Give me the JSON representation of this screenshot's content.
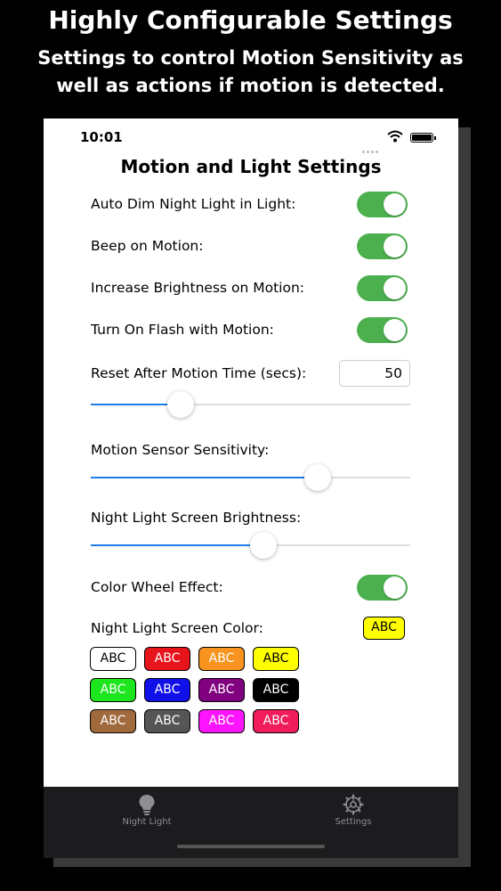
{
  "promo": {
    "title": "Highly Configurable Settings",
    "subtitle_line1": "Settings to control Motion Sensitivity as",
    "subtitle_line2": "well as actions if motion is detected."
  },
  "status_bar": {
    "time": "10:01"
  },
  "screen": {
    "title": "Motion and Light Settings",
    "toggles": [
      {
        "label": "Auto Dim Night Light in Light:",
        "on": true
      },
      {
        "label": "Beep on Motion:",
        "on": true
      },
      {
        "label": "Increase Brightness on Motion:",
        "on": true
      },
      {
        "label": "Turn On Flash with Motion:",
        "on": true
      }
    ],
    "reset_time": {
      "label": "Reset After Motion Time (secs):",
      "value": "50",
      "slider_fraction": 0.28
    },
    "motion_sensitivity": {
      "label": "Motion Sensor Sensitivity:",
      "slider_fraction": 0.71
    },
    "screen_brightness": {
      "label": "Night Light Screen Brightness:",
      "slider_fraction": 0.54
    },
    "color_wheel": {
      "label": "Color Wheel Effect:",
      "on": true
    },
    "screen_color": {
      "label": "Night Light Screen Color:",
      "selected_text": "ABC",
      "selected_bg": "#ffff00",
      "selected_fg": "#000000"
    },
    "swatch_text": "ABC",
    "swatches": [
      {
        "bg": "#ffffff",
        "fg": "#000000"
      },
      {
        "bg": "#e8141c",
        "fg": "#ffffff"
      },
      {
        "bg": "#f7931e",
        "fg": "#ffffff"
      },
      {
        "bg": "#ffff00",
        "fg": "#000000"
      },
      {
        "bg": "#1ee61e",
        "fg": "#ffffff"
      },
      {
        "bg": "#1010e8",
        "fg": "#ffffff"
      },
      {
        "bg": "#800080",
        "fg": "#ffffff"
      },
      {
        "bg": "#000000",
        "fg": "#ffffff"
      },
      {
        "bg": "#a06a3c",
        "fg": "#ffffff"
      },
      {
        "bg": "#555555",
        "fg": "#ffffff"
      },
      {
        "bg": "#ff14ff",
        "fg": "#ffffff"
      },
      {
        "bg": "#f01c5c",
        "fg": "#ffffff"
      }
    ]
  },
  "colors": {
    "toggle_on": "#4cb04f",
    "slider_fill": "#1d7ee6",
    "tabbar_bg": "#1c1c1e"
  },
  "tabbar": {
    "tabs": [
      {
        "label": "Night Light",
        "icon": "lightbulb-icon"
      },
      {
        "label": "Settings",
        "icon": "gear-icon"
      }
    ]
  }
}
